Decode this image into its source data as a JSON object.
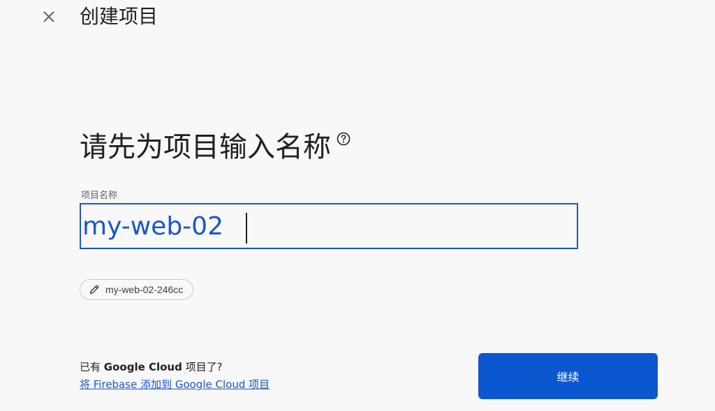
{
  "header": {
    "title": "创建项目",
    "close_icon": "close-icon"
  },
  "main": {
    "heading": "请先为项目输入名称",
    "help_icon": "help-circle-icon"
  },
  "project_name": {
    "label": "项目名称",
    "value": "my-web-02"
  },
  "project_id": {
    "value": "my-web-02-246cc",
    "icon": "pencil-icon"
  },
  "footer": {
    "question_prefix": "已有 ",
    "question_brand": "Google Cloud",
    "question_suffix": " 项目了?",
    "link_text": "将 Firebase 添加到 Google Cloud 项目"
  },
  "actions": {
    "continue_label": "继续"
  },
  "colors": {
    "accent": "#1a56c4",
    "button_bg": "#0b57d0",
    "background": "#f8f8f8"
  }
}
